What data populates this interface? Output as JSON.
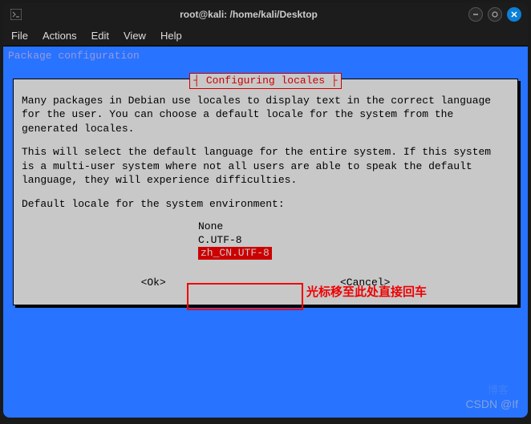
{
  "titlebar": {
    "title": "root@kali: /home/kali/Desktop"
  },
  "menubar": {
    "file": "File",
    "actions": "Actions",
    "edit": "Edit",
    "view": "View",
    "help": "Help"
  },
  "terminal": {
    "header": "Package configuration"
  },
  "dialog": {
    "title": "Configuring locales",
    "para1": "Many packages in Debian use locales to display text in the correct language for the user. You can choose a default locale for the system from the generated locales.",
    "para2": "This will select the default language for the entire system. If this system is a multi-user system where not all users are able to speak the default language, they will experience difficulties.",
    "prompt": "Default locale for the system environment:",
    "options": {
      "none": "None",
      "cutf8": "C.UTF-8",
      "zhcn": "zh_CN.UTF-8"
    },
    "ok": "<Ok>",
    "cancel": "<Cancel>"
  },
  "annotation": {
    "hint": "光标移至此处直接回车"
  },
  "watermark": {
    "main": "CSDN @If",
    "faint": "博客"
  }
}
